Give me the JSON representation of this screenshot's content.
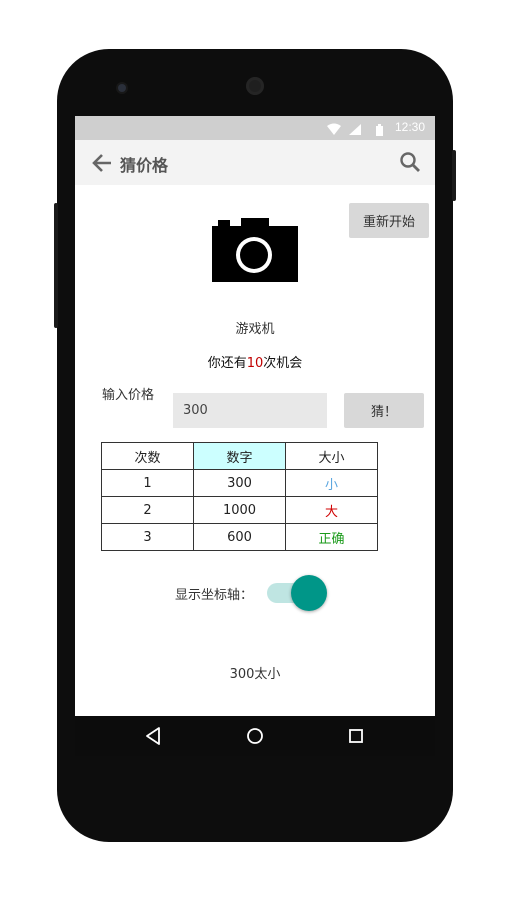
{
  "status_bar": {
    "time": "12:30",
    "icons": [
      "wifi-icon",
      "signal-icon",
      "battery-icon"
    ]
  },
  "app_bar": {
    "title": "猜价格",
    "back_icon": "arrow-left-icon",
    "search_icon": "search-icon"
  },
  "restart_button": "重新开始",
  "product": {
    "image_icon": "camera-icon",
    "name": "游戏机"
  },
  "chances": {
    "prefix": "你还有",
    "count": "10",
    "suffix": "次机会"
  },
  "price_input": {
    "label": "输入价格",
    "value": "300"
  },
  "guess_button": "猜！",
  "history": {
    "headers": [
      "次数",
      "数字",
      "大小"
    ],
    "rows": [
      {
        "n": "1",
        "number": "300",
        "size": "小",
        "size_color": "#5aa6e0"
      },
      {
        "n": "2",
        "number": "1000",
        "size": "大",
        "size_color": "#d00000"
      },
      {
        "n": "3",
        "number": "600",
        "size": "正确",
        "size_color": "#1a9a1a"
      }
    ],
    "highlight_header_color": "#ccffff"
  },
  "axis_toggle": {
    "label": "显示坐标轴：",
    "on": true,
    "color": "#009688"
  },
  "result_text": "300太小",
  "nav_bar": {
    "icons": [
      "back-triangle-icon",
      "home-circle-icon",
      "recents-square-icon"
    ]
  }
}
